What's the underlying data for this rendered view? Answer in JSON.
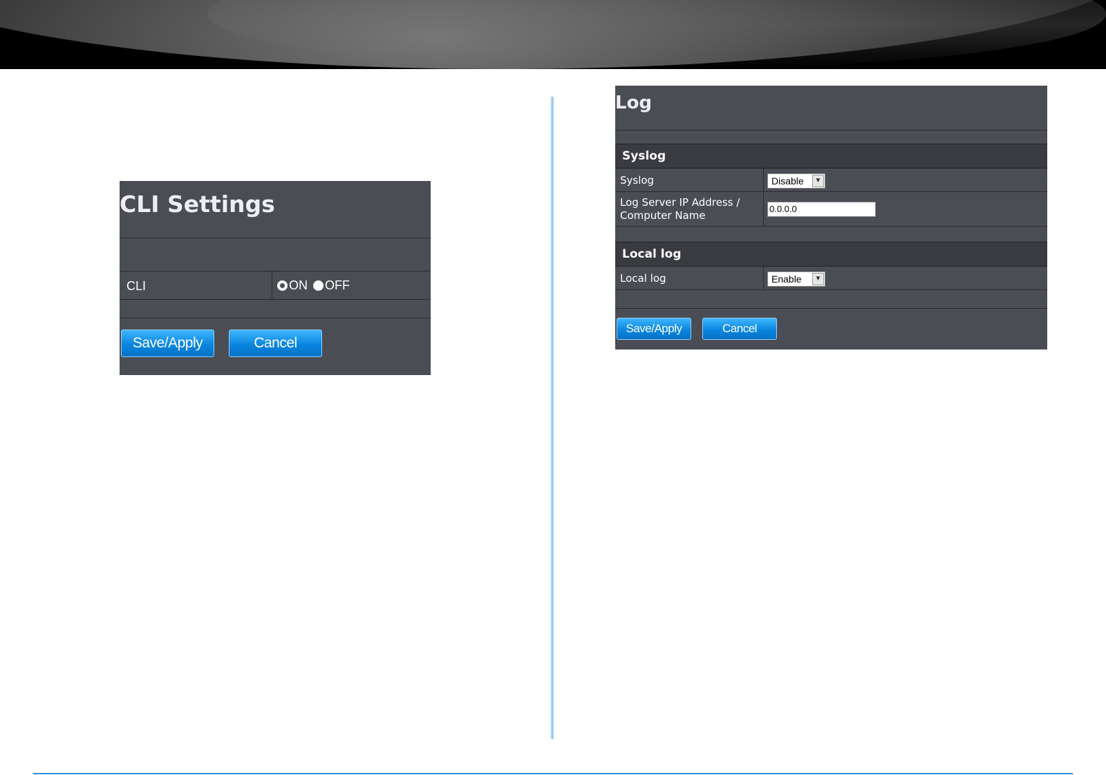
{
  "cli_settings": {
    "title": "CLI Settings",
    "cli_label": "CLI",
    "option_on": "ON",
    "option_off": "OFF",
    "save_label": "Save/Apply",
    "cancel_label": "Cancel"
  },
  "log": {
    "title": "Log",
    "syslog_section": "Syslog",
    "syslog_label": "Syslog",
    "syslog_value": "Disable",
    "server_label_line1": "Log Server IP Address /",
    "server_label_line2": "Computer Name",
    "server_value": "0.0.0.0",
    "local_section": "Local log",
    "local_label": "Local log",
    "local_value": "Enable",
    "save_label": "Save/Apply",
    "cancel_label": "Cancel"
  },
  "colors": {
    "panel_bg": "#4b4d54",
    "button_blue": "#0a86e0",
    "divider_blue": "#6fb6ee"
  }
}
